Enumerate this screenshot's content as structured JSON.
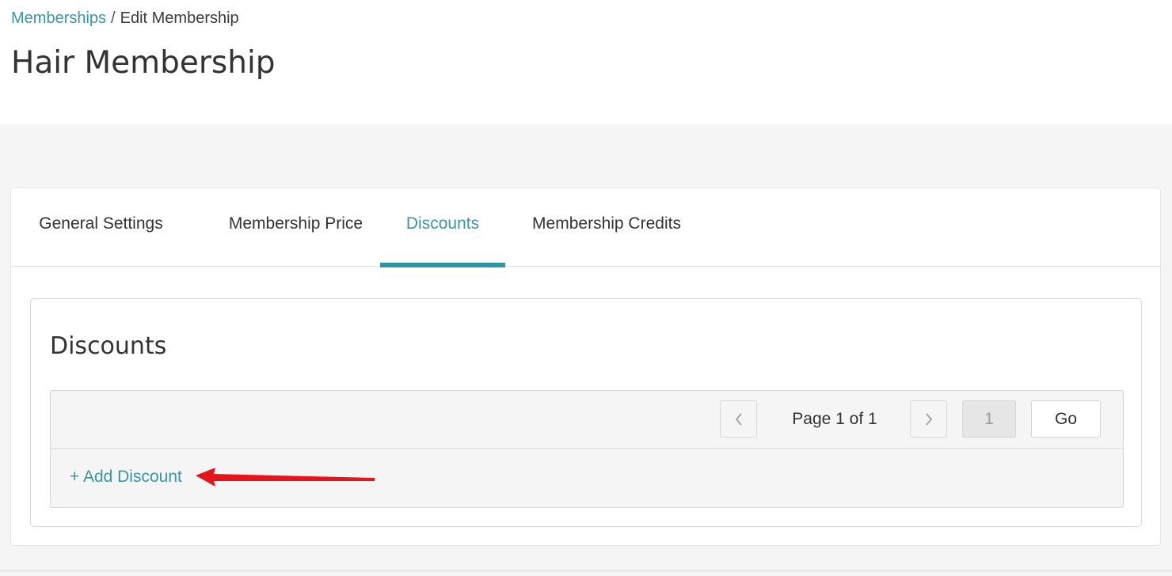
{
  "breadcrumb": {
    "parent": "Memberships",
    "separator": "/",
    "current": "Edit Membership"
  },
  "page_title": "Hair Membership",
  "tabs": [
    {
      "label": "General Settings",
      "active": false
    },
    {
      "label": "Membership Price",
      "active": false
    },
    {
      "label": "Discounts",
      "active": true
    },
    {
      "label": "Membership Credits",
      "active": false
    }
  ],
  "discounts": {
    "title": "Discounts",
    "pager": {
      "prev_icon": "chevron-left-icon",
      "next_icon": "chevron-right-icon",
      "label": "Page 1 of 1",
      "page_value": "1",
      "go_label": "Go"
    },
    "add_label": "+ Add Discount"
  },
  "colors": {
    "accent": "#2e96a3",
    "link": "#3a95a4",
    "annotation": "#e8141b"
  }
}
